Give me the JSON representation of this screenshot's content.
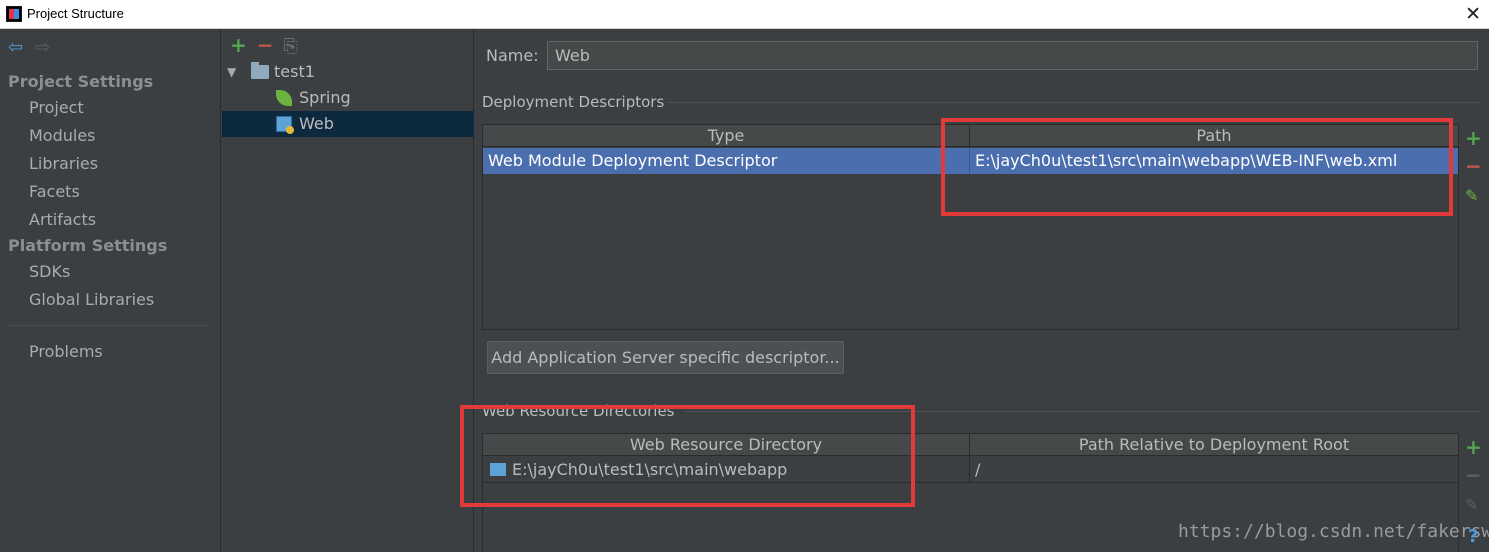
{
  "window": {
    "title": "Project Structure",
    "close_glyph": "✕"
  },
  "left_panel": {
    "back_glyph": "⇦",
    "forward_glyph": "⇨",
    "project_settings_header": "Project Settings",
    "project_items": [
      "Project",
      "Modules",
      "Libraries",
      "Facets",
      "Artifacts"
    ],
    "platform_settings_header": "Platform Settings",
    "platform_items": [
      "SDKs",
      "Global Libraries"
    ],
    "problems": "Problems"
  },
  "tree": {
    "toolbar": {
      "add": "+",
      "remove": "−",
      "copy": "⎘"
    },
    "expand_glyph": "▼",
    "root": "test1",
    "children": [
      "Spring",
      "Web"
    ],
    "selected": "Web"
  },
  "content": {
    "name_label": "Name:",
    "name_value": "Web",
    "deployment_descriptors": {
      "title": "Deployment Descriptors",
      "columns": [
        "Type",
        "Path"
      ],
      "rows": [
        {
          "type": "Web Module Deployment Descriptor",
          "path": "E:\\jayCh0u\\test1\\src\\main\\webapp\\WEB-INF\\web.xml"
        }
      ]
    },
    "add_server_descriptor_button": "Add Application Server specific descriptor...",
    "web_resource_directories": {
      "title": "Web Resource Directories",
      "columns": [
        "Web Resource Directory",
        "Path Relative to Deployment Root"
      ],
      "rows": [
        {
          "directory": "E:\\jayCh0u\\test1\\src\\main\\webapp",
          "relative_path": "/"
        }
      ]
    },
    "side_tools": {
      "add": "+",
      "remove": "−",
      "edit": "✎"
    },
    "help_glyph": "?"
  },
  "watermark": "https://blog.csdn.net/fakersw",
  "colors": {
    "background": "#3c3f41",
    "selection": "#4b6eaf",
    "tree_selection": "#0d293e",
    "annotation_red": "#e23a3a",
    "add_green": "#54a64f",
    "remove_red": "#c75450"
  }
}
